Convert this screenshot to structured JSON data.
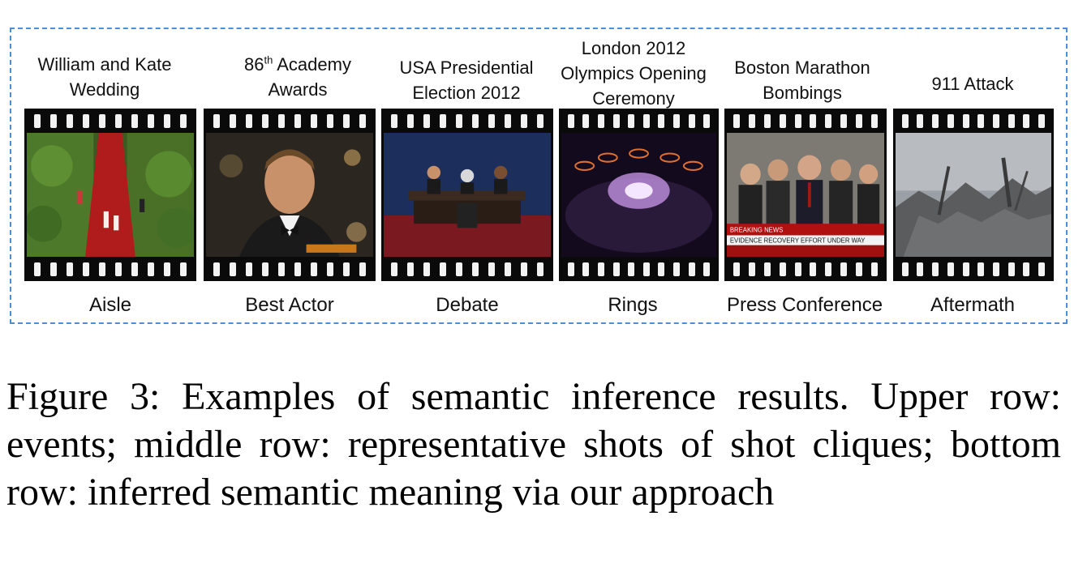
{
  "events": [
    {
      "title_lines": [
        "William and Kate",
        "Wedding"
      ],
      "label": "Aisle",
      "scene_icon": "wedding-aisle-image"
    },
    {
      "title_prefix": "86",
      "title_sup": "th",
      "title_rest": " Academy",
      "title_line2": "Awards",
      "label": "Best Actor",
      "scene_icon": "actor-image"
    },
    {
      "title_lines": [
        "USA Presidential",
        "Election 2012"
      ],
      "label": "Debate",
      "scene_icon": "debate-stage-image"
    },
    {
      "title_lines": [
        "London 2012",
        "Olympics Opening",
        "Ceremony"
      ],
      "label": "Rings",
      "scene_icon": "olympic-rings-image"
    },
    {
      "title_lines": [
        "Boston Marathon",
        "Bombings"
      ],
      "label": "Press Conference",
      "scene_icon": "press-conference-image",
      "ticker": [
        "BREAKING NEWS",
        "EVIDENCE RECOVERY EFFORT UNDER WAY"
      ]
    },
    {
      "title_lines": [
        "911 Attack"
      ],
      "label": "Aftermath",
      "scene_icon": "rubble-image"
    }
  ],
  "caption": "Figure 3: Examples of semantic inference results. Upper row: events; middle row: representative shots of shot cliques; bottom row: inferred semantic meaning via our approach",
  "colors": {
    "border": "#4a90d9",
    "film": "#0a0a0a"
  }
}
